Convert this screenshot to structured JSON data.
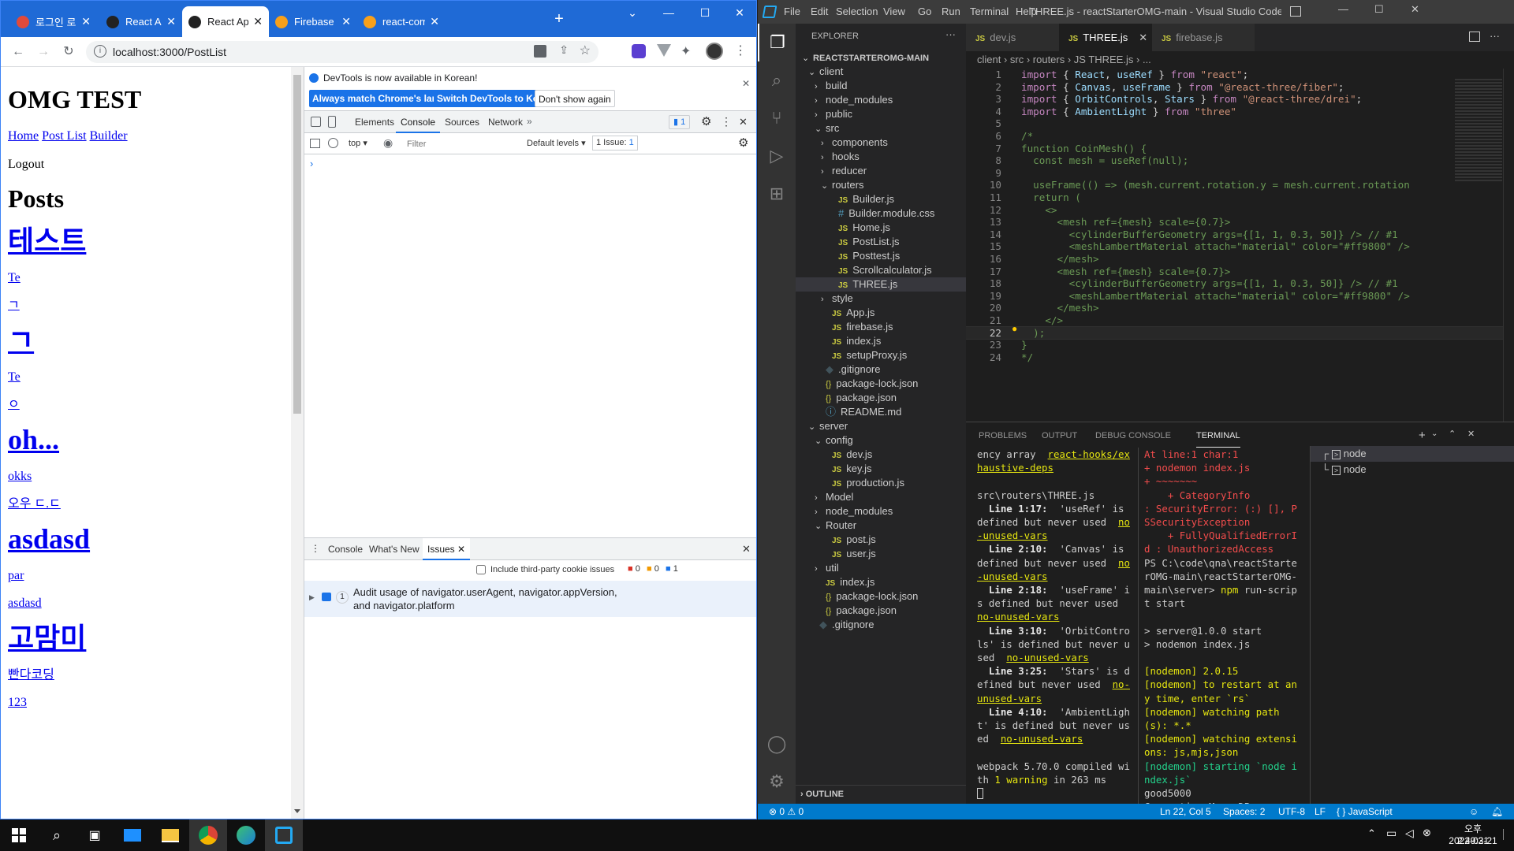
{
  "chrome": {
    "tabs": [
      {
        "title": "로그인 로그아",
        "fav": "#e04a3b"
      },
      {
        "title": "React App",
        "fav": "#222"
      },
      {
        "title": "React App",
        "fav": "#222",
        "active": true
      },
      {
        "title": "Firebase Con",
        "fav": "#f8a01b"
      },
      {
        "title": "react-commu",
        "fav": "#f8a01b"
      }
    ],
    "new_tab": "+",
    "url": "localhost:3000/PostList"
  },
  "page": {
    "title": "OMG TEST",
    "nav": [
      "Home",
      "Post List",
      "Builder"
    ],
    "logout": "Logout",
    "heading": "Posts",
    "posts": [
      {
        "title": "테스트",
        "lines": [
          "Te",
          "ㄱ"
        ]
      },
      {
        "title": "ㄱ",
        "lines": [
          "Te",
          "ㅇ"
        ]
      },
      {
        "title": "oh...",
        "lines": [
          "okks",
          "오우 ㄷ.ㄷ"
        ]
      },
      {
        "title": "asdasd",
        "lines": [
          "par",
          "asdasd"
        ]
      },
      {
        "title": "고맘미",
        "lines": [
          "빤다코딩",
          "123"
        ]
      }
    ]
  },
  "devtools": {
    "info": "DevTools is now available in Korean!",
    "btn_match": "Always match Chrome's language",
    "btn_switch": "Switch DevTools to Korean",
    "btn_dont": "Don't show again",
    "tabs": [
      "Elements",
      "Console",
      "Sources",
      "Network"
    ],
    "active_tab": "Console",
    "issue_badge": "1",
    "context": "top",
    "filter_placeholder": "Filter",
    "levels": "Default levels",
    "issue_count": "1 Issue:",
    "issue_count_num": "1",
    "prompt": "›",
    "drawer_tabs": [
      "Console",
      "What's New",
      "Issues"
    ],
    "third_party": "Include third-party cookie issues",
    "counts": {
      "errors": "0",
      "warnings": "0",
      "info": "1"
    },
    "issue_text": "Audit usage of navigator.userAgent, navigator.appVersion, and navigator.platform",
    "issue_num": "1"
  },
  "vscode": {
    "menus": [
      "File",
      "Edit",
      "Selection",
      "View",
      "Go",
      "Run",
      "Terminal",
      "Help"
    ],
    "title": "THREE.js - reactStarterOMG-main - Visual Studio Code [Administr...",
    "explorer_title": "EXPLORER",
    "tree": [
      {
        "d": 0,
        "t": "REACTSTARTEROMG-MAIN",
        "k": "root"
      },
      {
        "d": 1,
        "t": "client",
        "k": "open"
      },
      {
        "d": 2,
        "t": "build",
        "k": "closed"
      },
      {
        "d": 2,
        "t": "node_modules",
        "k": "closed"
      },
      {
        "d": 2,
        "t": "public",
        "k": "closed"
      },
      {
        "d": 2,
        "t": "src",
        "k": "open"
      },
      {
        "d": 3,
        "t": "components",
        "k": "closed"
      },
      {
        "d": 3,
        "t": "hooks",
        "k": "closed"
      },
      {
        "d": 3,
        "t": "reducer",
        "k": "closed"
      },
      {
        "d": 3,
        "t": "routers",
        "k": "open"
      },
      {
        "d": 4,
        "t": "Builder.js",
        "k": "js"
      },
      {
        "d": 4,
        "t": "Builder.module.css",
        "k": "css"
      },
      {
        "d": 4,
        "t": "Home.js",
        "k": "js"
      },
      {
        "d": 4,
        "t": "PostList.js",
        "k": "js"
      },
      {
        "d": 4,
        "t": "Posttest.js",
        "k": "js"
      },
      {
        "d": 4,
        "t": "Scrollcalculator.js",
        "k": "js"
      },
      {
        "d": 4,
        "t": "THREE.js",
        "k": "js",
        "sel": true
      },
      {
        "d": 3,
        "t": "style",
        "k": "closed"
      },
      {
        "d": 3,
        "t": "App.js",
        "k": "js"
      },
      {
        "d": 3,
        "t": "firebase.js",
        "k": "js"
      },
      {
        "d": 3,
        "t": "index.js",
        "k": "js"
      },
      {
        "d": 3,
        "t": "setupProxy.js",
        "k": "js"
      },
      {
        "d": 2,
        "t": ".gitignore",
        "k": "git"
      },
      {
        "d": 2,
        "t": "package-lock.json",
        "k": "json"
      },
      {
        "d": 2,
        "t": "package.json",
        "k": "json"
      },
      {
        "d": 2,
        "t": "README.md",
        "k": "md"
      },
      {
        "d": 1,
        "t": "server",
        "k": "open"
      },
      {
        "d": 2,
        "t": "config",
        "k": "open"
      },
      {
        "d": 3,
        "t": "dev.js",
        "k": "js"
      },
      {
        "d": 3,
        "t": "key.js",
        "k": "js"
      },
      {
        "d": 3,
        "t": "production.js",
        "k": "js"
      },
      {
        "d": 2,
        "t": "Model",
        "k": "closed"
      },
      {
        "d": 2,
        "t": "node_modules",
        "k": "closed"
      },
      {
        "d": 2,
        "t": "Router",
        "k": "open"
      },
      {
        "d": 3,
        "t": "post.js",
        "k": "js"
      },
      {
        "d": 3,
        "t": "user.js",
        "k": "js"
      },
      {
        "d": 2,
        "t": "util",
        "k": "closed"
      },
      {
        "d": 2,
        "t": "index.js",
        "k": "js"
      },
      {
        "d": 2,
        "t": "package-lock.json",
        "k": "json"
      },
      {
        "d": 2,
        "t": "package.json",
        "k": "json"
      },
      {
        "d": 1,
        "t": ".gitignore",
        "k": "git"
      }
    ],
    "outline": "OUTLINE",
    "editor_tabs": [
      "dev.js",
      "THREE.js",
      "firebase.js"
    ],
    "active_editor_tab": "THREE.js",
    "breadcrumbs": "client › src › routers › JS THREE.js › ...",
    "code": [
      [
        [
          "kw",
          "import "
        ],
        [
          "pl",
          "{ "
        ],
        [
          "id",
          "React"
        ],
        [
          "pl",
          ", "
        ],
        [
          "id",
          "useRef"
        ],
        [
          "pl",
          " } "
        ],
        [
          "kw",
          "from "
        ],
        [
          "str",
          "\"react\""
        ],
        [
          "pl",
          ";"
        ]
      ],
      [
        [
          "kw",
          "import "
        ],
        [
          "pl",
          "{ "
        ],
        [
          "id",
          "Canvas"
        ],
        [
          "pl",
          ", "
        ],
        [
          "id",
          "useFrame"
        ],
        [
          "pl",
          " } "
        ],
        [
          "kw",
          "from "
        ],
        [
          "str",
          "\"@react-three/fiber\""
        ],
        [
          "pl",
          ";"
        ]
      ],
      [
        [
          "kw",
          "import "
        ],
        [
          "pl",
          "{ "
        ],
        [
          "id",
          "OrbitControls"
        ],
        [
          "pl",
          ", "
        ],
        [
          "id",
          "Stars"
        ],
        [
          "pl",
          " } "
        ],
        [
          "kw",
          "from "
        ],
        [
          "str",
          "\"@react-three/drei\""
        ],
        [
          "pl",
          ";"
        ]
      ],
      [
        [
          "kw",
          "import "
        ],
        [
          "pl",
          "{ "
        ],
        [
          "id",
          "AmbientLight"
        ],
        [
          "pl",
          " } "
        ],
        [
          "kw",
          "from "
        ],
        [
          "str",
          "\"three\""
        ]
      ],
      [],
      [
        [
          "cm",
          "/*"
        ]
      ],
      [
        [
          "cm",
          "function CoinMesh() {"
        ]
      ],
      [
        [
          "cm",
          "  const mesh = useRef(null);"
        ]
      ],
      [],
      [
        [
          "cm",
          "  useFrame(() => (mesh.current.rotation.y = mesh.current.rotation"
        ]
      ],
      [
        [
          "cm",
          "  return ("
        ]
      ],
      [
        [
          "cm",
          "    <>"
        ]
      ],
      [
        [
          "cm",
          "      <mesh ref={mesh} scale={0.7}>"
        ]
      ],
      [
        [
          "cm",
          "        <cylinderBufferGeometry args={[1, 1, 0.3, 50]} /> // #1"
        ]
      ],
      [
        [
          "cm",
          "        <meshLambertMaterial attach=\"material\" color=\"#ff9800\" />"
        ]
      ],
      [
        [
          "cm",
          "      </mesh>"
        ]
      ],
      [
        [
          "cm",
          "      <mesh ref={mesh} scale={0.7}>"
        ]
      ],
      [
        [
          "cm",
          "        <cylinderBufferGeometry args={[1, 1, 0.3, 50]} /> // #1"
        ]
      ],
      [
        [
          "cm",
          "        <meshLambertMaterial attach=\"material\" color=\"#ff9800\" />"
        ]
      ],
      [
        [
          "cm",
          "      </mesh>"
        ]
      ],
      [
        [
          "cm",
          "    </>"
        ]
      ],
      [
        [
          "cm",
          "  );"
        ]
      ],
      [
        [
          "cm",
          "}"
        ]
      ],
      [
        [
          "cm",
          "*/"
        ]
      ]
    ],
    "panel_tabs": [
      "PROBLEMS",
      "OUTPUT",
      "DEBUG CONSOLE",
      "TERMINAL"
    ],
    "active_panel_tab": "TERMINAL",
    "term_left": [
      [
        [
          "t",
          "ency array  "
        ],
        [
          "u",
          "react-hooks/exhaustive-deps"
        ]
      ],
      [
        [
          "t",
          " "
        ]
      ],
      [
        [
          "t",
          "src\\routers\\THREE.js"
        ]
      ],
      [
        [
          "b",
          "  Line 1:17:"
        ],
        [
          "t",
          "  'useRef' is defined but never used  "
        ],
        [
          "u",
          "no-unused-vars"
        ]
      ],
      [
        [
          "b",
          "  Line 2:10:"
        ],
        [
          "t",
          "  'Canvas' is defined but never used  "
        ],
        [
          "u",
          "no-unused-vars"
        ]
      ],
      [
        [
          "b",
          "  Line 2:18:"
        ],
        [
          "t",
          "  'useFrame' is defined but never used  "
        ],
        [
          "u",
          "no-unused-vars"
        ]
      ],
      [
        [
          "b",
          "  Line 3:10:"
        ],
        [
          "t",
          "  'OrbitControls' is defined but never used  "
        ],
        [
          "u",
          "no-unused-vars"
        ]
      ],
      [
        [
          "b",
          "  Line 3:25:"
        ],
        [
          "t",
          "  'Stars' is defined but never used  "
        ],
        [
          "u",
          "no-unused-vars"
        ]
      ],
      [
        [
          "b",
          "  Line 4:10:"
        ],
        [
          "t",
          "  'AmbientLight' is defined but never used  "
        ],
        [
          "u",
          "no-unused-vars"
        ]
      ],
      [
        [
          "t",
          " "
        ]
      ],
      [
        [
          "t",
          "webpack 5.70.0 compiled with "
        ],
        [
          "y",
          "1 warning"
        ],
        [
          "t",
          " in 263 ms"
        ]
      ]
    ],
    "term_right": [
      [
        [
          "r",
          "At line:1 char:1"
        ]
      ],
      [
        [
          "r",
          "+ nodemon index.js"
        ]
      ],
      [
        [
          "r",
          "+ ~~~~~~~"
        ]
      ],
      [
        [
          "r",
          "    + CategoryInfo          : SecurityError: (:) [], PSSecurityException"
        ]
      ],
      [
        [
          "r",
          "    + FullyQualifiedErrorId : UnauthorizedAccess"
        ]
      ],
      [
        [
          "t",
          "PS C:\\code\\qna\\reactStarterOMG-main\\reactStarterOMG-main\\server> "
        ],
        [
          "y",
          "npm"
        ],
        [
          "t",
          " run-script start"
        ]
      ],
      [
        [
          "t",
          " "
        ]
      ],
      [
        [
          "t",
          "> server@1.0.0 start"
        ]
      ],
      [
        [
          "t",
          "> nodemon index.js"
        ]
      ],
      [
        [
          "t",
          " "
        ]
      ],
      [
        [
          "y",
          "[nodemon] 2.0.15"
        ]
      ],
      [
        [
          "y",
          "[nodemon] to restart at any time, enter `rs`"
        ]
      ],
      [
        [
          "y",
          "[nodemon] watching path(s): *.*"
        ]
      ],
      [
        [
          "y",
          "[nodemon] watching extensions: js,mjs,json"
        ]
      ],
      [
        [
          "g",
          "[nodemon] starting `node index.js`"
        ]
      ],
      [
        [
          "t",
          "good5000"
        ]
      ],
      [
        [
          "t",
          "Connecting MongoDB..."
        ]
      ]
    ],
    "term_sessions": [
      "node",
      "node"
    ],
    "status": {
      "problems_err": "0",
      "problems_warn": "0",
      "position": "Ln 22, Col 5",
      "spaces": "Spaces: 2",
      "encoding": "UTF-8",
      "eol": "LF",
      "language": "JavaScript"
    }
  },
  "taskbar": {
    "time": "오후 2:49:21",
    "date": "2022-03-21"
  }
}
